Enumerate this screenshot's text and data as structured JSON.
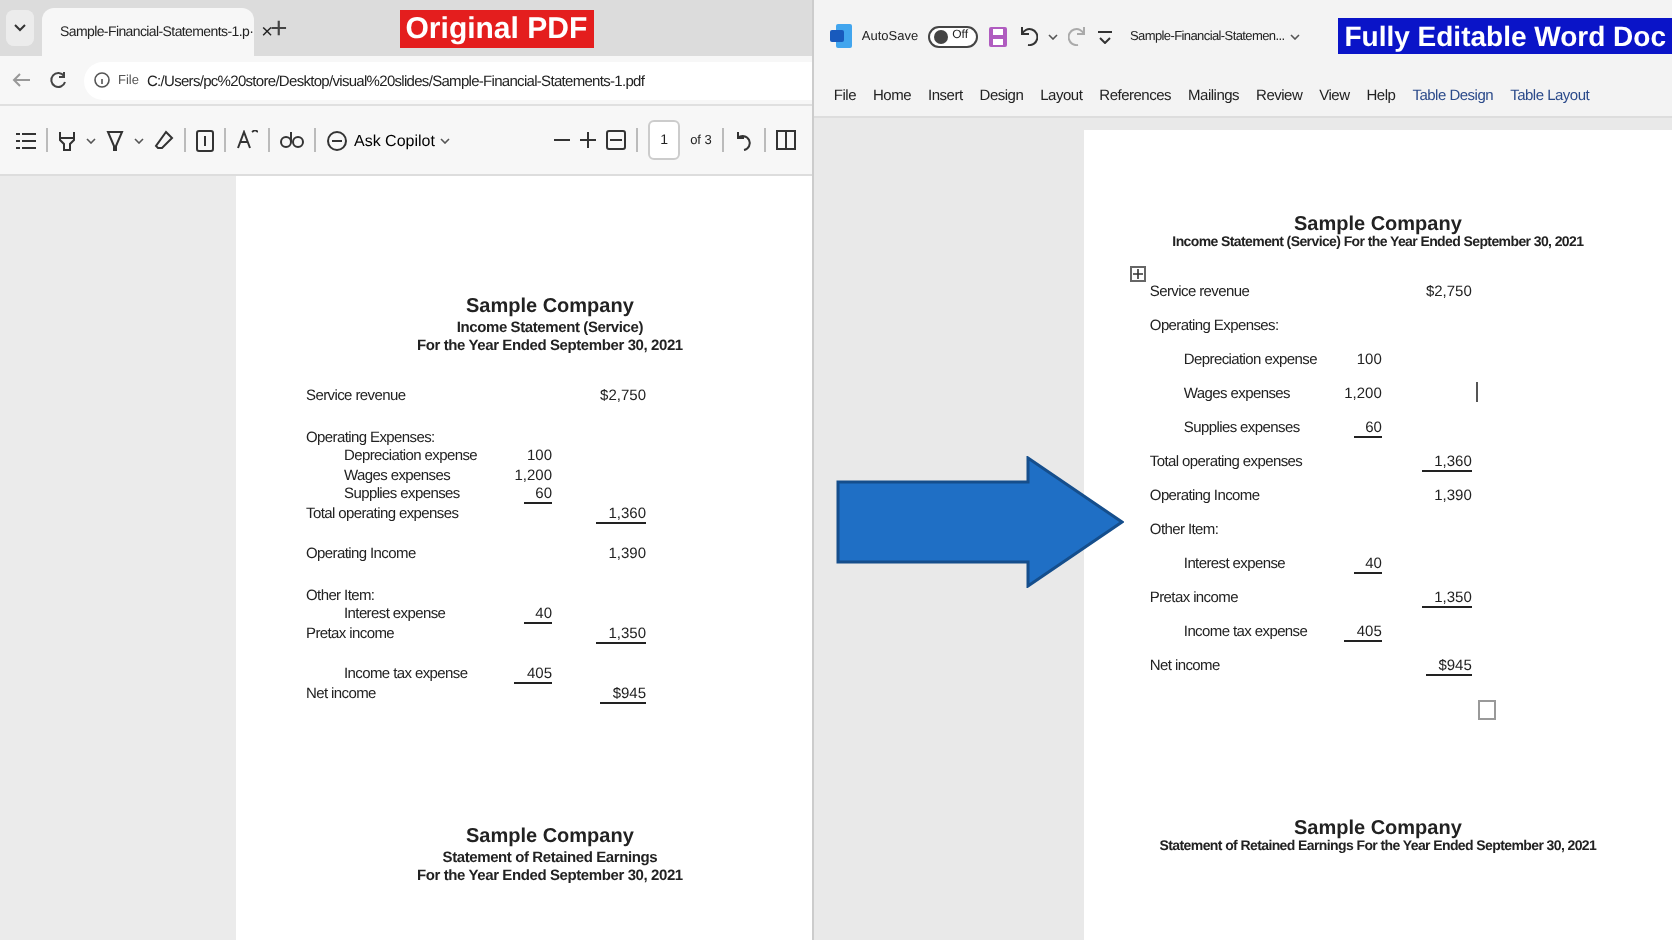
{
  "pdf_viewer": {
    "tab": {
      "title": "Sample-Financial-Statements-1.p·",
      "close": "×"
    },
    "new_tab": "+",
    "banner": "Original PDF",
    "address": {
      "prefix": "File",
      "url": "C:/Users/pc%20store/Desktop/visual%20slides/Sample-Financial-Statements-1.pdf"
    },
    "toolbar": {
      "ask_copilot": "Ask Copilot",
      "page_number": "1",
      "page_total": "of 3"
    },
    "document": {
      "title": "Sample Company",
      "subtitle": "Income Statement (Service)",
      "period": "For the Year Ended September 30, 2021",
      "sections": [
        [
          {
            "label": "Service revenue",
            "kind": "item",
            "col2": "$2,750"
          }
        ],
        [
          {
            "label": "Operating Expenses:",
            "kind": "item"
          },
          {
            "label": "Depreciation expense",
            "kind": "subitem",
            "col1": "100"
          },
          {
            "label": "Wages expenses",
            "kind": "subitem",
            "col1": "1,200"
          },
          {
            "label": "Supplies expenses",
            "kind": "subitem",
            "col1": "60",
            "underlined": true
          },
          {
            "label": "Total operating expenses",
            "kind": "item",
            "col2": "1,360",
            "underlined": true
          }
        ],
        [
          {
            "label": "Operating Income",
            "kind": "item",
            "col2": "1,390"
          }
        ],
        [
          {
            "label": "Other Item:",
            "kind": "item"
          },
          {
            "label": "Interest expense",
            "kind": "subitem",
            "col1": "40",
            "underlined": true
          },
          {
            "label": "Pretax income",
            "kind": "item",
            "col2": "1,350",
            "underlined": true
          }
        ],
        [
          {
            "label": "Income tax expense",
            "kind": "subitem",
            "col1": "405",
            "underlined": true
          },
          {
            "label": "Net income",
            "kind": "item",
            "col2": "$945",
            "underlined": true
          }
        ]
      ],
      "next_section": {
        "title": "Sample Company",
        "subtitle": "Statement of Retained Earnings",
        "period": "For the Year Ended September 30, 2021"
      }
    }
  },
  "word": {
    "autosave": "AutoSave",
    "autosave_toggle": {
      "label": "Off",
      "on": false
    },
    "file_name": "Sample-Financial-Statemen...",
    "banner": "Fully Editable Word Doc",
    "menu": [
      {
        "label": "File",
        "kind": "tab"
      },
      {
        "label": "Home",
        "kind": "tab"
      },
      {
        "label": "Insert",
        "kind": "tab"
      },
      {
        "label": "Design",
        "kind": "tab"
      },
      {
        "label": "Layout",
        "kind": "tab"
      },
      {
        "label": "References",
        "kind": "tab"
      },
      {
        "label": "Mailings",
        "kind": "tab"
      },
      {
        "label": "Review",
        "kind": "tab"
      },
      {
        "label": "View",
        "kind": "tab"
      },
      {
        "label": "Help",
        "kind": "tab"
      },
      {
        "label": "Table Design",
        "kind": "contextual"
      },
      {
        "label": "Table Layout",
        "kind": "contextual"
      }
    ],
    "document": {
      "title": "Sample Company",
      "heading": "Income Statement (Service) For the Year Ended September 30, 2021",
      "rows": [
        {
          "label": "Service revenue",
          "kind": "item",
          "col2": "$2,750"
        },
        {
          "label": "Operating Expenses:",
          "kind": "item"
        },
        {
          "label": "Depreciation expense",
          "kind": "subitem",
          "col1": "100"
        },
        {
          "label": "Wages expenses",
          "kind": "subitem",
          "col1": "1,200"
        },
        {
          "label": "Supplies expenses",
          "kind": "subitem",
          "col1": "60",
          "underlined": true
        },
        {
          "label": "Total operating expenses",
          "kind": "item",
          "col2": "1,360",
          "underlined": true
        },
        {
          "label": "Operating Income",
          "kind": "item",
          "col2": "1,390"
        },
        {
          "label": "Other Item:",
          "kind": "item"
        },
        {
          "label": "Interest expense",
          "kind": "subitem",
          "col1": "40",
          "underlined": true
        },
        {
          "label": "Pretax income",
          "kind": "item",
          "col2": "1,350",
          "underlined": true
        },
        {
          "label": "Income tax expense",
          "kind": "subitem",
          "col1": "405",
          "underlined": true
        },
        {
          "label": "Net income",
          "kind": "item",
          "col2": "$945",
          "underlined": true
        }
      ],
      "next_section": {
        "title": "Sample Company",
        "heading": "Statement of Retained Earnings For the Year Ended September 30, 2021"
      }
    }
  }
}
